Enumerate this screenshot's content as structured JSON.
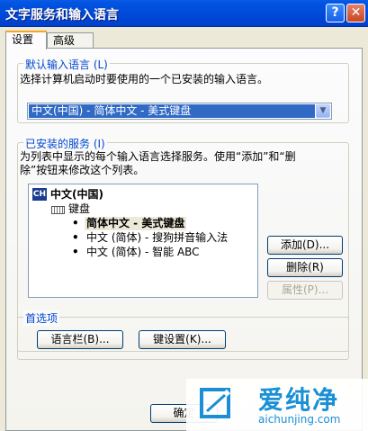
{
  "window": {
    "title": "文字服务和输入语言",
    "help_label": "?",
    "close_label": "✕"
  },
  "tabs": [
    {
      "label": "设置",
      "active": true
    },
    {
      "label": "高级",
      "active": false
    }
  ],
  "default_language": {
    "legend": "默认输入语言 (L)",
    "description": "选择计算机启动时要使用的一个已安装的输入语言。",
    "selected": "中文(中国) - 简体中文 - 美式键盘"
  },
  "installed_services": {
    "legend": "已安装的服务 (I)",
    "description_line1": "为列表中显示的每个输入语言选择服务。使用“添加”和“删",
    "description_line2": "除”按钮来修改这个列表。",
    "language": {
      "icon": "CH",
      "label": "中文(中国)"
    },
    "category": {
      "label": "键盘"
    },
    "items": [
      {
        "label": "简体中文 - 美式键盘",
        "selected": true
      },
      {
        "label": "中文 (简体) - 搜狗拼音输入法",
        "selected": false
      },
      {
        "label": "中文 (简体) - 智能 ABC",
        "selected": false
      }
    ],
    "buttons": {
      "add": "添加(D)...",
      "remove": "删除(R)",
      "properties": "属性(P)..."
    }
  },
  "preferences": {
    "legend": "首选项",
    "language_bar": "语言栏(B)...",
    "key_settings": "键设置(K)..."
  },
  "footer": {
    "ok_label": "确定"
  },
  "watermark": {
    "brand": "爱纯净",
    "url": "aichunjing.com"
  },
  "colors": {
    "titlebar": "#0048d8",
    "legend_text": "#0046d5",
    "selection": "#316ac5",
    "watermark": "#1a8fd6"
  }
}
